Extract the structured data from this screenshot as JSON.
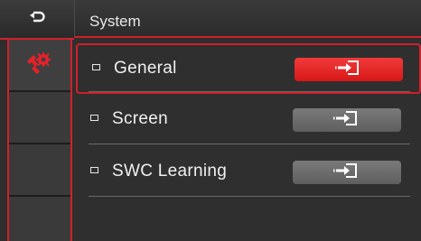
{
  "header": {
    "title": "System"
  },
  "back_icon": "back-arrow-icon",
  "sidebar": {
    "items": [
      {
        "icon": "wrench-gear-icon",
        "active": true
      }
    ]
  },
  "menu": {
    "items": [
      {
        "label": "General",
        "selected": true,
        "action_icon": "enter-arrow-icon"
      },
      {
        "label": "Screen",
        "selected": false,
        "action_icon": "enter-arrow-icon"
      },
      {
        "label": "SWC Learning",
        "selected": false,
        "action_icon": "enter-arrow-icon"
      }
    ]
  },
  "colors": {
    "accent": "#d1202b",
    "button_active": "#e62222",
    "button_idle": "#6b6b6b",
    "background": "#2e2e2e"
  }
}
